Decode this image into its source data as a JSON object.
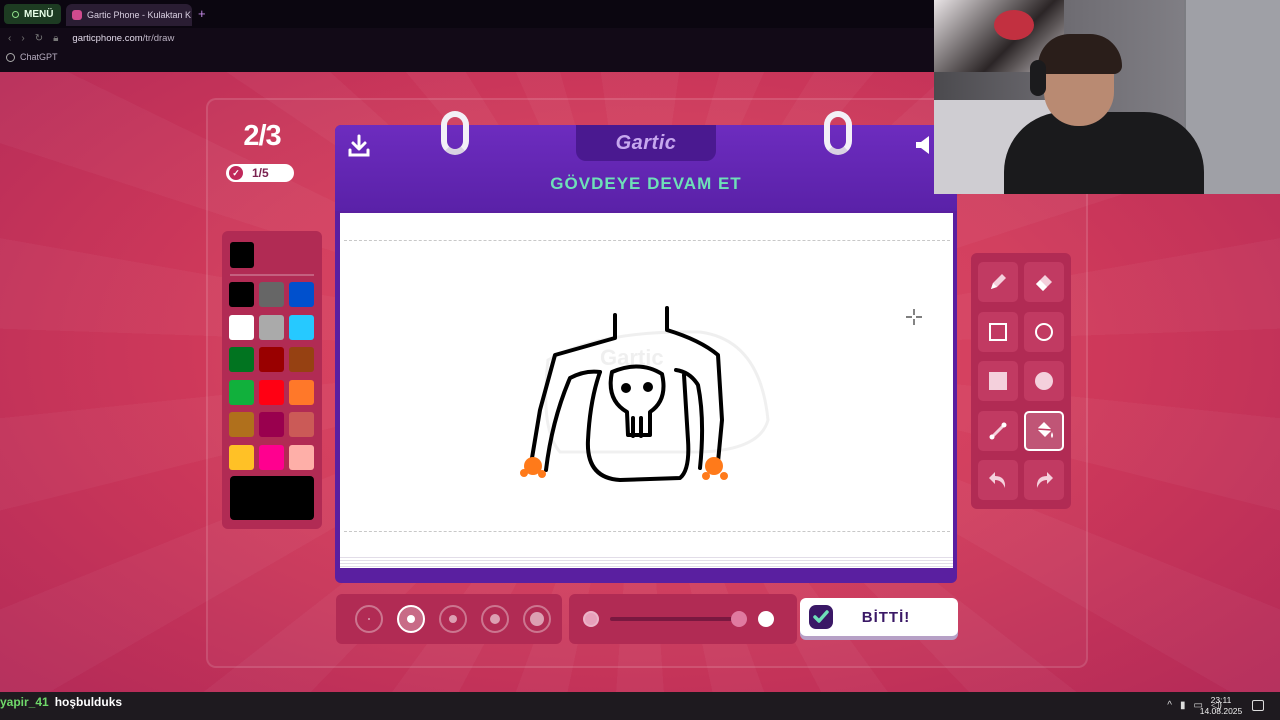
{
  "browser": {
    "menu_label": "MENÜ",
    "tab_title": "Gartic Phone - Kulaktan K",
    "url_host": "garticphone.com",
    "url_path": "/tr/draw",
    "bookmark_label": "ChatGPT"
  },
  "game": {
    "round": "2/3",
    "done_count": "1/5",
    "logo": "Gartic",
    "task": "GÖVDEYE DEVAM ET",
    "done_button": "BİTTİ!",
    "selected_color": "#000000",
    "colors": [
      "#000000",
      "#666666",
      "#0050cd",
      "#ffffff",
      "#aaaaaa",
      "#26c9ff",
      "#017420",
      "#990000",
      "#964112",
      "#11b03c",
      "#ff0013",
      "#ff7829",
      "#b0701c",
      "#99004e",
      "#cb5a57",
      "#ffc126",
      "#ff008f",
      "#feafa8"
    ],
    "tools": [
      {
        "name": "pencil-tool",
        "icon": "pencil-icon"
      },
      {
        "name": "eraser-tool",
        "icon": "eraser-icon"
      },
      {
        "name": "rectangle-outline-tool",
        "icon": "square-outline-icon"
      },
      {
        "name": "ellipse-outline-tool",
        "icon": "circle-outline-icon"
      },
      {
        "name": "rectangle-fill-tool",
        "icon": "square-filled-icon"
      },
      {
        "name": "ellipse-fill-tool",
        "icon": "circle-filled-icon"
      },
      {
        "name": "line-tool",
        "icon": "line-icon"
      },
      {
        "name": "fill-bucket-tool",
        "icon": "bucket-icon"
      },
      {
        "name": "undo-tool",
        "icon": "undo-icon"
      },
      {
        "name": "redo-tool",
        "icon": "redo-icon"
      }
    ],
    "active_tool": "fill-bucket-tool",
    "brush_sizes": 5,
    "selected_brush_size": 2
  },
  "overlay": {
    "chat_user": "yapir_41",
    "chat_message": "hoşbulduks"
  },
  "taskbar": {
    "time": "23:11",
    "date": "14.08.2025"
  }
}
